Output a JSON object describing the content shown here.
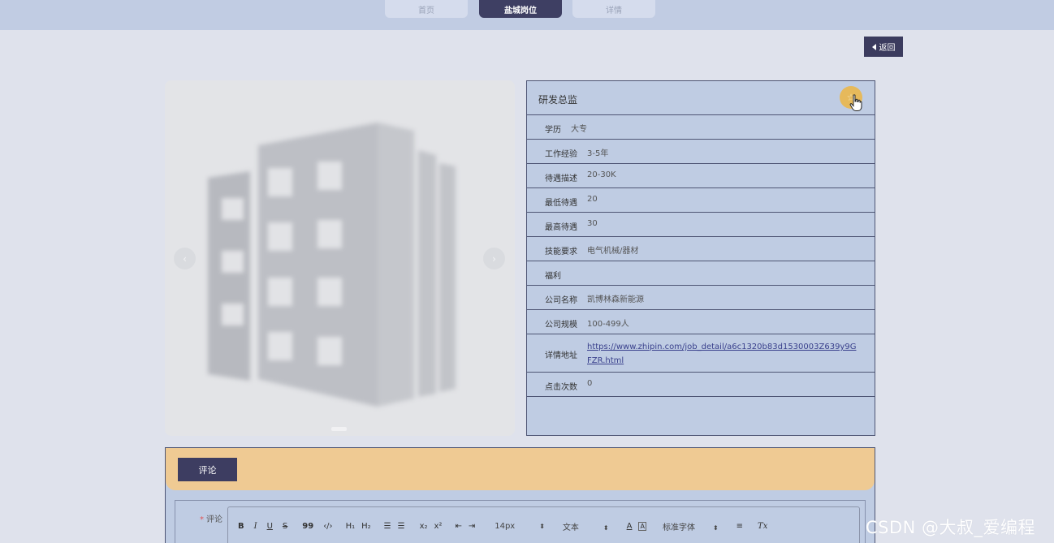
{
  "nav": {
    "tabs": [
      {
        "label": "首页",
        "active": false
      },
      {
        "label": "盐城岗位",
        "active": true
      },
      {
        "label": "详情",
        "active": false
      }
    ]
  },
  "back_button": {
    "label": "返回"
  },
  "carousel": {
    "prev_icon": "chevron-left-icon",
    "next_icon": "chevron-right-icon",
    "prev_glyph": "‹",
    "next_glyph": "›"
  },
  "job": {
    "title": "研发总监",
    "favorite_icon": "star-icon",
    "favorite_glyph": "☆",
    "rows": [
      {
        "label": "学历",
        "value": "大专"
      },
      {
        "label": "工作经验",
        "value": "3-5年"
      },
      {
        "label": "待遇描述",
        "value": "20-30K"
      },
      {
        "label": "最低待遇",
        "value": "20"
      },
      {
        "label": "最高待遇",
        "value": "30"
      },
      {
        "label": "技能要求",
        "value": "电气机械/器材"
      },
      {
        "label": "福利",
        "value": ""
      },
      {
        "label": "公司名称",
        "value": "凯博林森新能源"
      },
      {
        "label": "公司规模",
        "value": "100-499人"
      },
      {
        "label": "详情地址",
        "value": "https://www.zhipin.com/job_detail/a6c1320b83d1530003Z639y9GFZR.html"
      },
      {
        "label": "点击次数",
        "value": "0"
      }
    ]
  },
  "comments": {
    "tab_label": "评论",
    "field_label": "评论",
    "required_mark": "*",
    "toolbar": {
      "bold": "B",
      "italic": "I",
      "underline": "U",
      "strike": "S",
      "blockquote": "99",
      "code": "‹/›",
      "h1": "H₁",
      "h2": "H₂",
      "ordered_list": "☰",
      "bullet_list": "☰",
      "subscript": "x₂",
      "superscript": "x²",
      "outdent": "⇤",
      "indent": "⇥",
      "size_select": "14px",
      "header_select": "文本",
      "font_color": "A",
      "background_color": "A",
      "font_select": "标准字体",
      "align": "≡",
      "clean": "Tx",
      "select_caret": "⬍"
    }
  },
  "watermark": "CSDN @大叔_爱编程"
}
